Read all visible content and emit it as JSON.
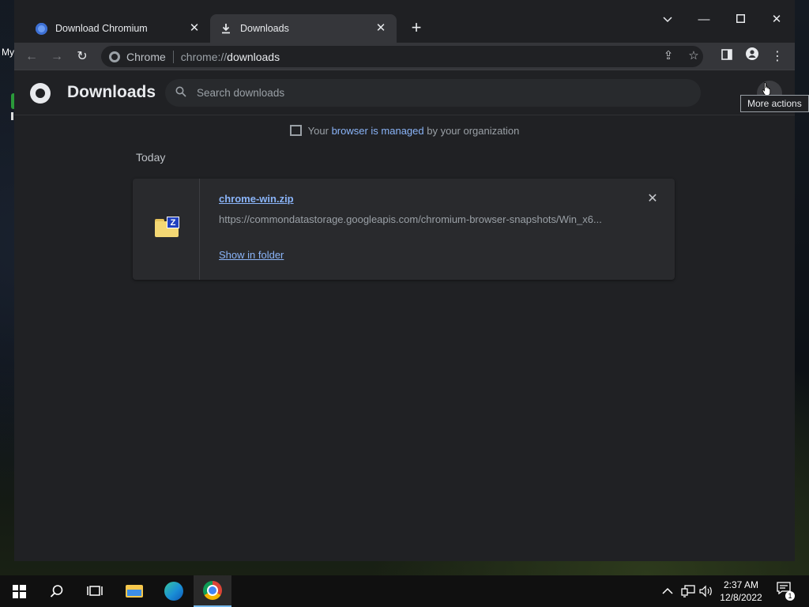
{
  "desktop": {
    "partial_label": "My"
  },
  "tabs": [
    {
      "title": "Download Chromium",
      "active": false
    },
    {
      "title": "Downloads",
      "active": true
    }
  ],
  "toolbar": {
    "site_chip": "Chrome",
    "url_scheme": "chrome://",
    "url_host": "downloads"
  },
  "page": {
    "title": "Downloads",
    "search_placeholder": "Search downloads",
    "more_actions_tooltip": "More actions",
    "managed_notice": {
      "prefix": "Your ",
      "link": "browser is managed",
      "suffix": " by your organization"
    },
    "section_date": "Today",
    "downloads": [
      {
        "file_name": "chrome-win.zip",
        "url": "https://commondatastorage.googleapis.com/chromium-browser-snapshots/Win_x6...",
        "action": "Show in folder"
      }
    ]
  },
  "taskbar": {
    "time": "2:37 AM",
    "date": "12/8/2022",
    "notification_count": "1"
  },
  "colors": {
    "accent": "#8ab4f8",
    "page_bg": "#202124",
    "card_bg": "#292a2d",
    "toolbar_bg": "#35363a",
    "taskbar_active": "#76b9ed"
  }
}
